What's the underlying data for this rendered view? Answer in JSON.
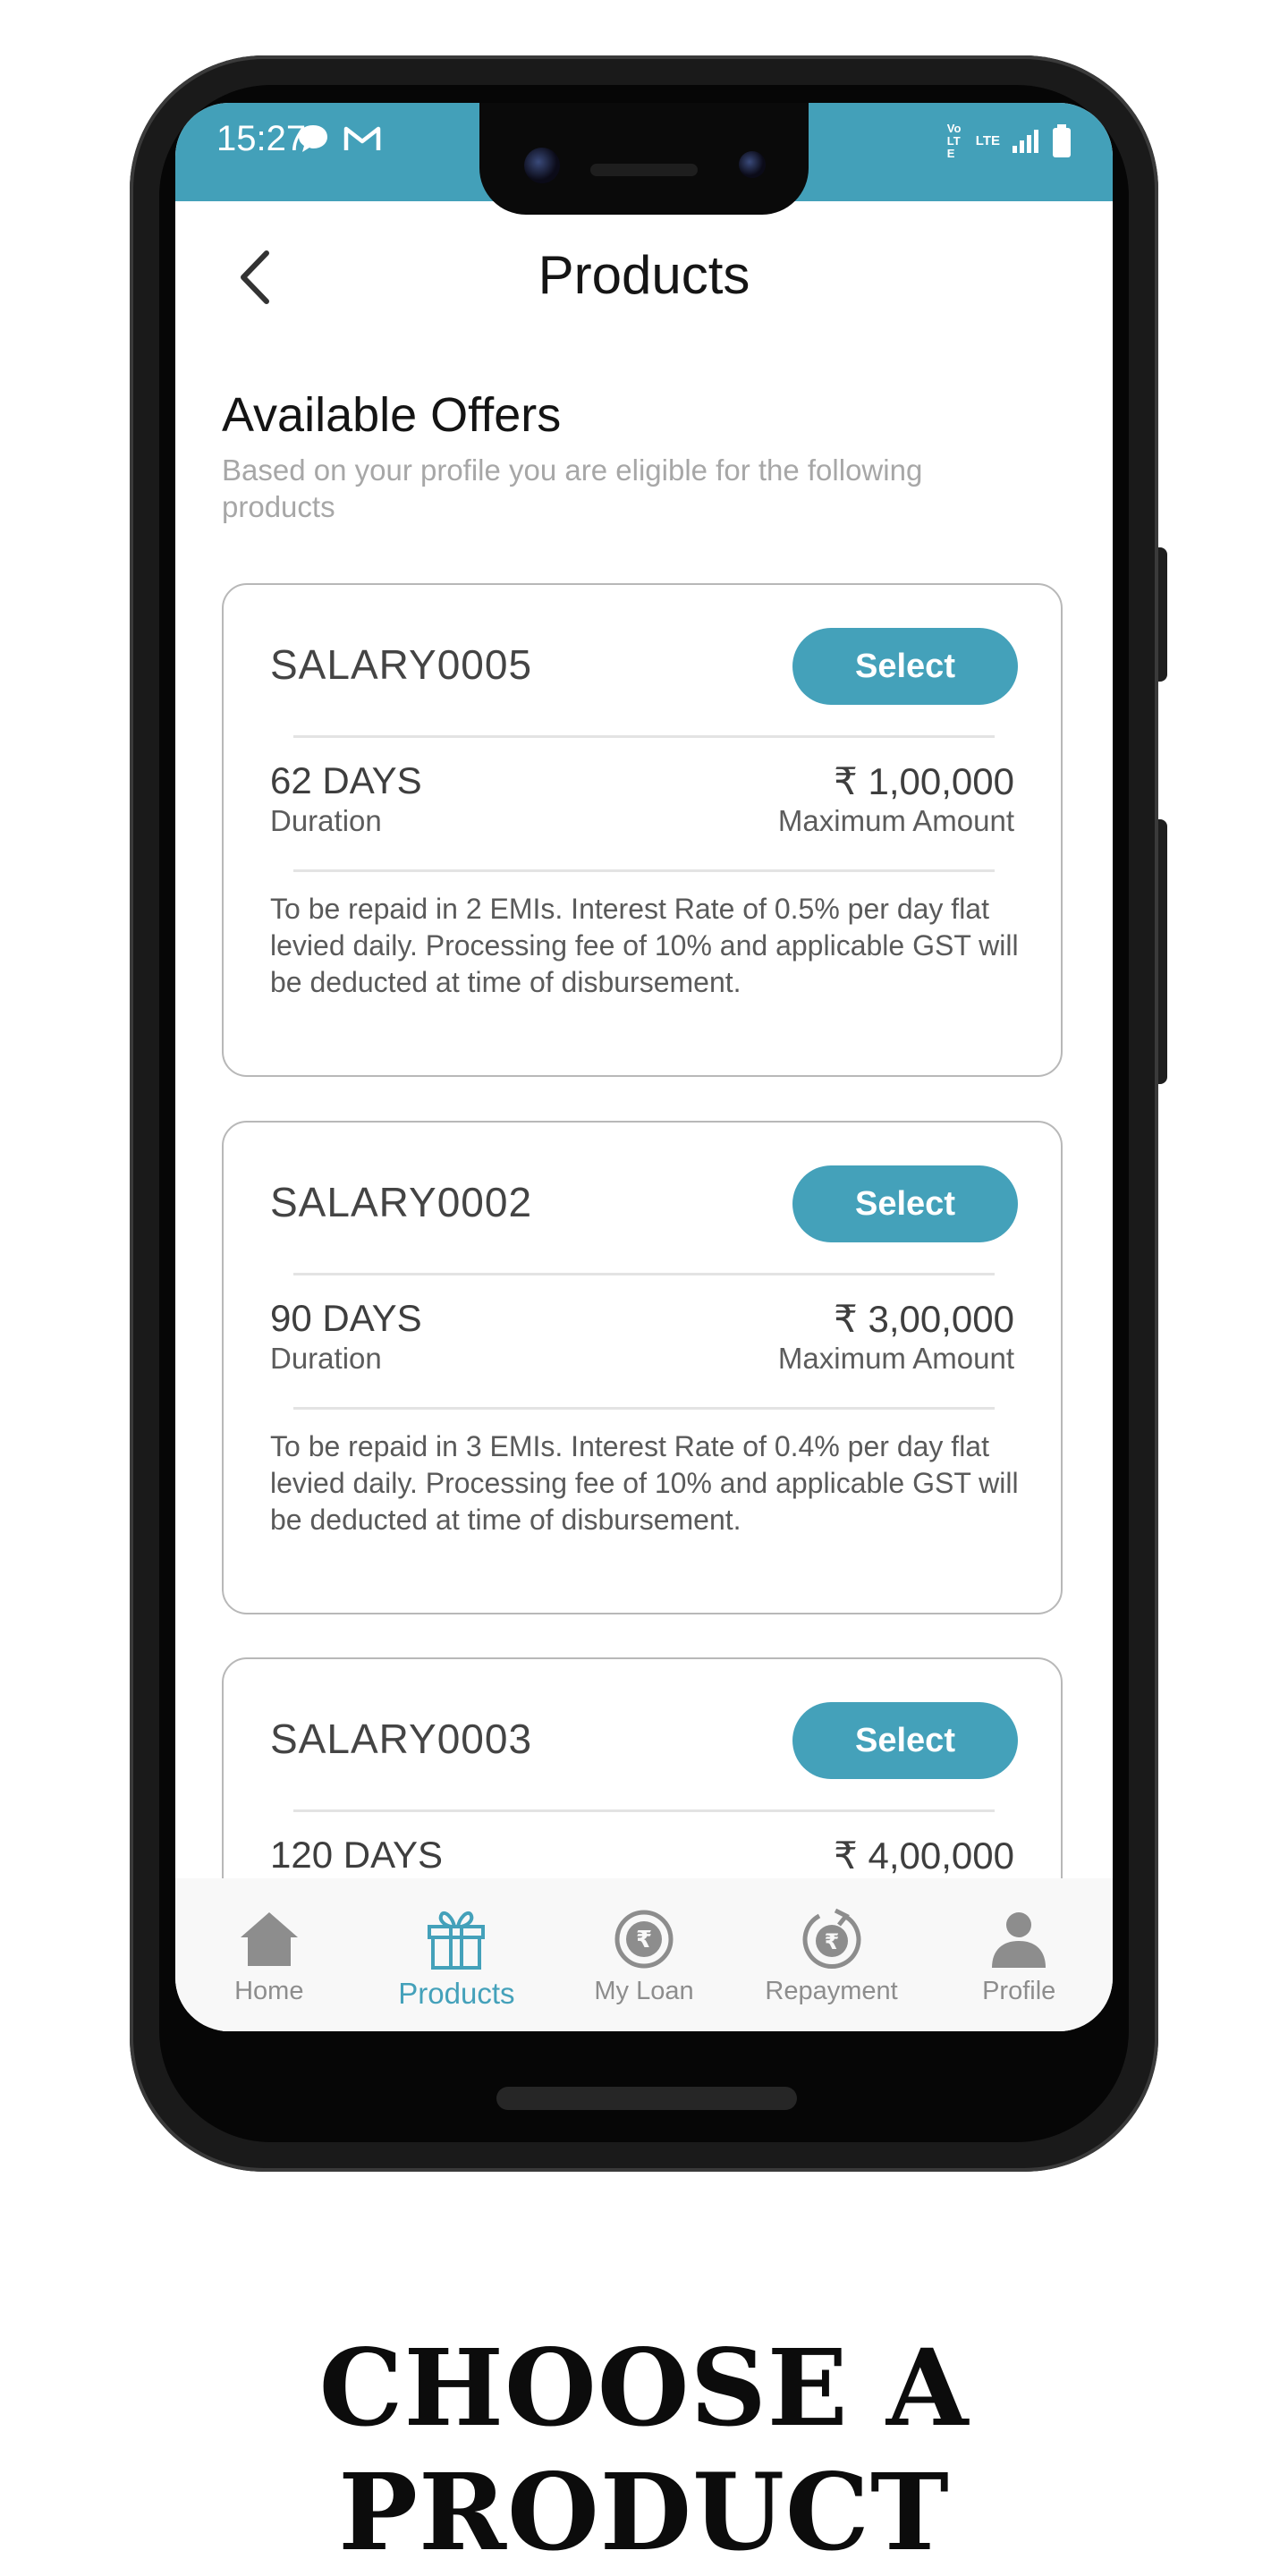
{
  "status_bar": {
    "time": "15:27",
    "network_label": "Vo LTE",
    "lte_label": "LTE"
  },
  "header": {
    "title": "Products"
  },
  "offers": {
    "title": "Available Offers",
    "subtitle": "Based on your profile you are eligible for the following products"
  },
  "products": [
    {
      "name": "SALARY0005",
      "select_label": "Select",
      "duration": "62 DAYS",
      "duration_label": "Duration",
      "amount": "₹ 1,00,000",
      "amount_label": "Maximum Amount",
      "description": "To be repaid in 2 EMIs. Interest Rate of 0.5% per day flat levied daily. Processing fee of 10% and applicable GST will be deducted at time of disbursement."
    },
    {
      "name": "SALARY0002",
      "select_label": "Select",
      "duration": "90 DAYS",
      "duration_label": "Duration",
      "amount": "₹ 3,00,000",
      "amount_label": "Maximum Amount",
      "description": "To be repaid in 3 EMIs. Interest Rate of 0.4% per day flat levied daily. Processing fee of 10% and applicable GST will be deducted at time of disbursement."
    },
    {
      "name": "SALARY0003",
      "select_label": "Select",
      "duration": "120 DAYS",
      "amount": "₹ 4,00,000"
    }
  ],
  "nav": {
    "items": [
      {
        "label": "Home",
        "icon": "home-icon",
        "active": false
      },
      {
        "label": "Products",
        "icon": "gift-icon",
        "active": true
      },
      {
        "label": "My Loan",
        "icon": "rupee-coin-icon",
        "active": false
      },
      {
        "label": "Repayment",
        "icon": "rupee-refresh-icon",
        "active": false
      },
      {
        "label": "Profile",
        "icon": "person-icon",
        "active": false
      }
    ]
  },
  "caption": "CHOOSE A PRODUCT",
  "colors": {
    "accent": "#44a1ba",
    "status_bar": "#43a0b9",
    "inactive": "#8d8d8d"
  }
}
